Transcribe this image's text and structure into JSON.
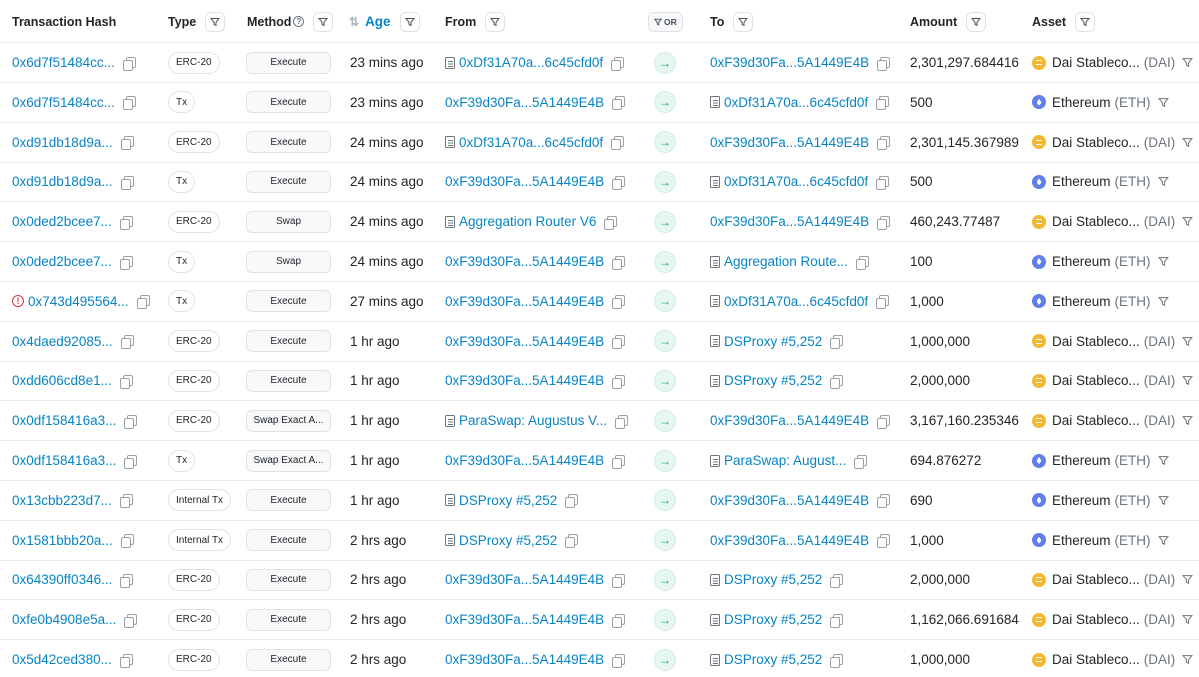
{
  "columns": {
    "hash": "Transaction Hash",
    "type": "Type",
    "method": "Method",
    "age": "Age",
    "from": "From",
    "or": "OR",
    "to": "To",
    "amount": "Amount",
    "asset": "Asset"
  },
  "rows": [
    {
      "hash": "0x6d7f51484cc...",
      "error": false,
      "type": "ERC-20",
      "method": "Execute",
      "age": "23 mins ago",
      "from": "0xDf31A70a...6c45cfd0f",
      "from_contract": true,
      "to": "0xF39d30Fa...5A1449E4B",
      "to_contract": false,
      "amount": "2,301,297.684416",
      "asset": "Dai Stableco...",
      "symbol": "(DAI)",
      "coin": "dai"
    },
    {
      "hash": "0x6d7f51484cc...",
      "error": false,
      "type": "Tx",
      "method": "Execute",
      "age": "23 mins ago",
      "from": "0xF39d30Fa...5A1449E4B",
      "from_contract": false,
      "to": "0xDf31A70a...6c45cfd0f",
      "to_contract": true,
      "amount": "500",
      "asset": "Ethereum",
      "symbol": "(ETH)",
      "coin": "eth"
    },
    {
      "hash": "0xd91db18d9a...",
      "error": false,
      "type": "ERC-20",
      "method": "Execute",
      "age": "24 mins ago",
      "from": "0xDf31A70a...6c45cfd0f",
      "from_contract": true,
      "to": "0xF39d30Fa...5A1449E4B",
      "to_contract": false,
      "amount": "2,301,145.367989",
      "asset": "Dai Stableco...",
      "symbol": "(DAI)",
      "coin": "dai"
    },
    {
      "hash": "0xd91db18d9a...",
      "error": false,
      "type": "Tx",
      "method": "Execute",
      "age": "24 mins ago",
      "from": "0xF39d30Fa...5A1449E4B",
      "from_contract": false,
      "to": "0xDf31A70a...6c45cfd0f",
      "to_contract": true,
      "amount": "500",
      "asset": "Ethereum",
      "symbol": "(ETH)",
      "coin": "eth"
    },
    {
      "hash": "0x0ded2bcee7...",
      "error": false,
      "type": "ERC-20",
      "method": "Swap",
      "age": "24 mins ago",
      "from": "Aggregation Router V6",
      "from_contract": true,
      "to": "0xF39d30Fa...5A1449E4B",
      "to_contract": false,
      "amount": "460,243.77487",
      "asset": "Dai Stableco...",
      "symbol": "(DAI)",
      "coin": "dai"
    },
    {
      "hash": "0x0ded2bcee7...",
      "error": false,
      "type": "Tx",
      "method": "Swap",
      "age": "24 mins ago",
      "from": "0xF39d30Fa...5A1449E4B",
      "from_contract": false,
      "to": "Aggregation Route...",
      "to_contract": true,
      "amount": "100",
      "asset": "Ethereum",
      "symbol": "(ETH)",
      "coin": "eth"
    },
    {
      "hash": "0x743d495564...",
      "error": true,
      "type": "Tx",
      "method": "Execute",
      "age": "27 mins ago",
      "from": "0xF39d30Fa...5A1449E4B",
      "from_contract": false,
      "to": "0xDf31A70a...6c45cfd0f",
      "to_contract": true,
      "amount": "1,000",
      "asset": "Ethereum",
      "symbol": "(ETH)",
      "coin": "eth"
    },
    {
      "hash": "0x4daed92085...",
      "error": false,
      "type": "ERC-20",
      "method": "Execute",
      "age": "1 hr ago",
      "from": "0xF39d30Fa...5A1449E4B",
      "from_contract": false,
      "to": "DSProxy #5,252",
      "to_contract": true,
      "amount": "1,000,000",
      "asset": "Dai Stableco...",
      "symbol": "(DAI)",
      "coin": "dai"
    },
    {
      "hash": "0xdd606cd8e1...",
      "error": false,
      "type": "ERC-20",
      "method": "Execute",
      "age": "1 hr ago",
      "from": "0xF39d30Fa...5A1449E4B",
      "from_contract": false,
      "to": "DSProxy #5,252",
      "to_contract": true,
      "amount": "2,000,000",
      "asset": "Dai Stableco...",
      "symbol": "(DAI)",
      "coin": "dai"
    },
    {
      "hash": "0x0df158416a3...",
      "error": false,
      "type": "ERC-20",
      "method": "Swap Exact A...",
      "age": "1 hr ago",
      "from": "ParaSwap: Augustus V...",
      "from_contract": true,
      "to": "0xF39d30Fa...5A1449E4B",
      "to_contract": false,
      "amount": "3,167,160.235346",
      "asset": "Dai Stableco...",
      "symbol": "(DAI)",
      "coin": "dai"
    },
    {
      "hash": "0x0df158416a3...",
      "error": false,
      "type": "Tx",
      "method": "Swap Exact A...",
      "age": "1 hr ago",
      "from": "0xF39d30Fa...5A1449E4B",
      "from_contract": false,
      "to": "ParaSwap: August...",
      "to_contract": true,
      "amount": "694.876272",
      "asset": "Ethereum",
      "symbol": "(ETH)",
      "coin": "eth"
    },
    {
      "hash": "0x13cbb223d7...",
      "error": false,
      "type": "Internal Tx",
      "method": "Execute",
      "age": "1 hr ago",
      "from": "DSProxy #5,252",
      "from_contract": true,
      "to": "0xF39d30Fa...5A1449E4B",
      "to_contract": false,
      "amount": "690",
      "asset": "Ethereum",
      "symbol": "(ETH)",
      "coin": "eth"
    },
    {
      "hash": "0x1581bbb20a...",
      "error": false,
      "type": "Internal Tx",
      "method": "Execute",
      "age": "2 hrs ago",
      "from": "DSProxy #5,252",
      "from_contract": true,
      "to": "0xF39d30Fa...5A1449E4B",
      "to_contract": false,
      "amount": "1,000",
      "asset": "Ethereum",
      "symbol": "(ETH)",
      "coin": "eth"
    },
    {
      "hash": "0x64390ff0346...",
      "error": false,
      "type": "ERC-20",
      "method": "Execute",
      "age": "2 hrs ago",
      "from": "0xF39d30Fa...5A1449E4B",
      "from_contract": false,
      "to": "DSProxy #5,252",
      "to_contract": true,
      "amount": "2,000,000",
      "asset": "Dai Stableco...",
      "symbol": "(DAI)",
      "coin": "dai"
    },
    {
      "hash": "0xfe0b4908e5a...",
      "error": false,
      "type": "ERC-20",
      "method": "Execute",
      "age": "2 hrs ago",
      "from": "0xF39d30Fa...5A1449E4B",
      "from_contract": false,
      "to": "DSProxy #5,252",
      "to_contract": true,
      "amount": "1,162,066.691684",
      "asset": "Dai Stableco...",
      "symbol": "(DAI)",
      "coin": "dai"
    },
    {
      "hash": "0x5d42ced380...",
      "error": false,
      "type": "ERC-20",
      "method": "Execute",
      "age": "2 hrs ago",
      "from": "0xF39d30Fa...5A1449E4B",
      "from_contract": false,
      "to": "DSProxy #5,252",
      "to_contract": true,
      "amount": "1,000,000",
      "asset": "Dai Stableco...",
      "symbol": "(DAI)",
      "coin": "dai"
    }
  ]
}
